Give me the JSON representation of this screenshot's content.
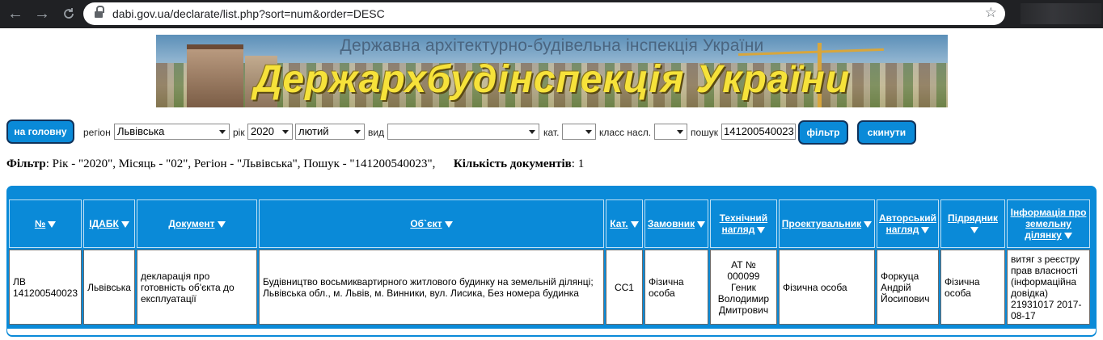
{
  "browser": {
    "url": "dabi.gov.ua/declarate/list.php?sort=num&order=DESC",
    "back_glyph": "←",
    "forward_glyph": "→",
    "star_glyph": "☆"
  },
  "banner": {
    "subtitle": "Державна архітектурно-будівельна інспекція України",
    "title": "Держархбудінспекція України"
  },
  "toolbar": {
    "home_label": "на головну",
    "region_label": "регіон",
    "region_value": "Львівська",
    "year_label": "рік",
    "year_value": "2020",
    "month_value": "лютий",
    "type_label": "вид",
    "type_value": "",
    "cat_label": "кат.",
    "cat_value": "",
    "class_label": "класс насл.",
    "class_value": "",
    "search_label": "пошук",
    "search_value": "141200540023",
    "filter_label": "фільтр",
    "reset_label": "скинути"
  },
  "filter_info": {
    "filter_key": "Фільтр",
    "filter_text": ": Рік - \"2020\", Місяць - \"02\", Регіон - \"Львівська\", Пошук - \"141200540023\",",
    "count_key": "Кількість документів",
    "count_text": ": 1"
  },
  "table": {
    "headers": [
      "№",
      "ІДАБК",
      "Документ",
      "Об`єкт",
      "Кат.",
      "Замовник",
      "Технічний нагляд",
      "Проектувальник",
      "Авторський нагляд",
      "Підрядник",
      "Інформація про земельну ділянку"
    ],
    "rows": [
      {
        "num": "ЛВ 141200540023",
        "idabk": "Львівська",
        "document": "декларація про готовність об'єкта до експлуатації",
        "object": "Будівництво восьмиквартирного житлового будинку на земельній ділянці; Львівська обл., м. Львів, м. Винники, вул. Лисика, Без номера будинка",
        "cat": "СС1",
        "customer": "Фізична особа",
        "supervision": "АТ № 000099 Геник Володимир Дмитрович",
        "designer": "Фізична особа",
        "author_supervision": "Форкуца Андрій Йосипович",
        "contractor": "Фізична особа",
        "land_info": "витяг з реєстру прав власності (інформаційна довідка) 21931017 2017-08-17"
      }
    ]
  }
}
